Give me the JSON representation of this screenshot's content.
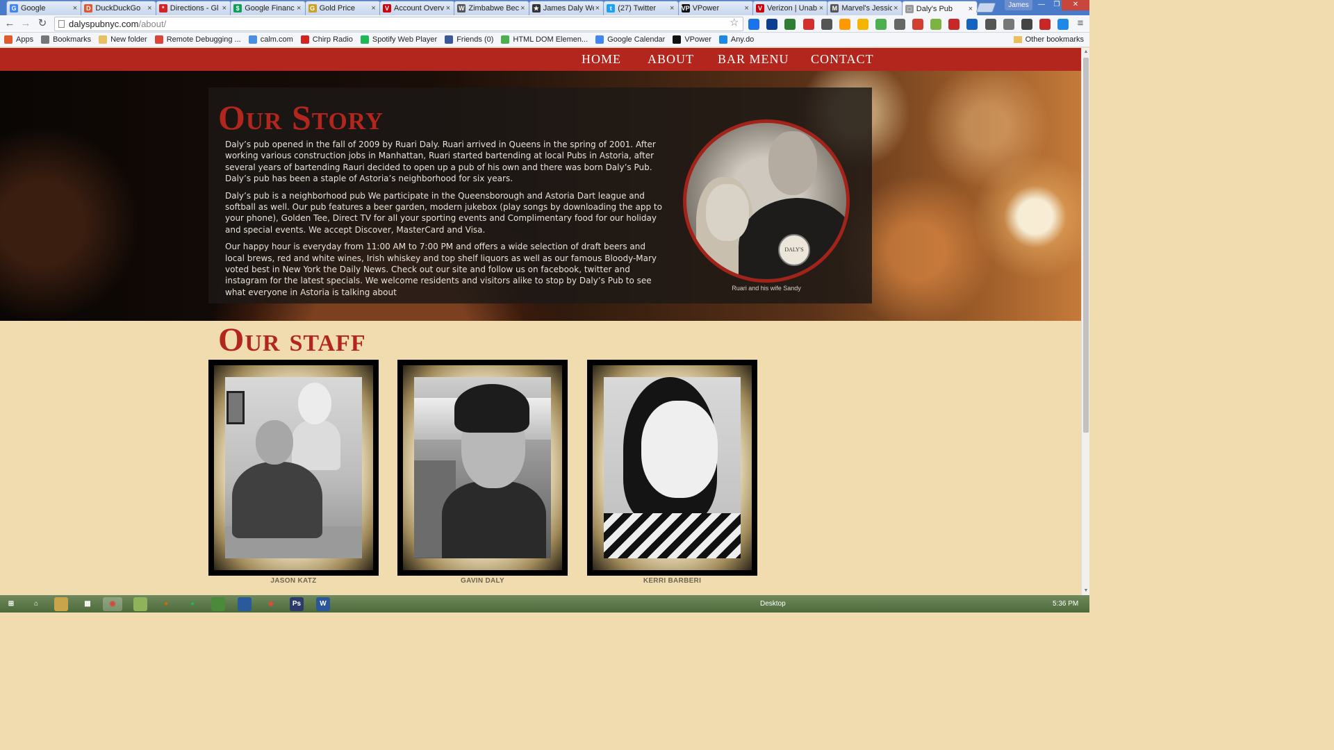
{
  "browser": {
    "tabs": [
      {
        "label": "Google",
        "fav": "G",
        "color": "#4285f4",
        "active": false
      },
      {
        "label": "DuckDuckGo",
        "fav": "D",
        "color": "#de5833",
        "active": false
      },
      {
        "label": "Directions - Gl",
        "fav": "*",
        "color": "#d32323",
        "active": false
      },
      {
        "label": "Google Financ",
        "fav": "$",
        "color": "#0f9d58",
        "active": false
      },
      {
        "label": "Gold Price",
        "fav": "G",
        "color": "#c9a227",
        "active": false
      },
      {
        "label": "Account Overv",
        "fav": "V",
        "color": "#cd040b",
        "active": false
      },
      {
        "label": "Zimbabwe Bec",
        "fav": "W",
        "color": "#555555",
        "active": false
      },
      {
        "label": "James Daly We",
        "fav": "★",
        "color": "#333333",
        "active": false
      },
      {
        "label": "(27) Twitter",
        "fav": "t",
        "color": "#1da1f2",
        "active": false
      },
      {
        "label": "VPower",
        "fav": "VP",
        "color": "#111111",
        "active": false
      },
      {
        "label": "Verizon | Unab",
        "fav": "V",
        "color": "#cd040b",
        "active": false
      },
      {
        "label": "Marvel's Jessic",
        "fav": "M",
        "color": "#555555",
        "active": false
      },
      {
        "label": "Daly's Pub",
        "fav": "□",
        "color": "#999999",
        "active": true
      }
    ],
    "tab_close": "×",
    "profile_name": "James",
    "url_host": "dalyspubnyc.com",
    "url_path": "/about/",
    "nav_back": "←",
    "nav_forward": "→",
    "nav_reload": "↻",
    "star": "☆",
    "menu": "≡",
    "bookmarks": [
      {
        "label": "Apps",
        "icon": "apps-icon",
        "color": "#e0592a"
      },
      {
        "label": "Bookmarks",
        "icon": "star-icon",
        "color": "#777777"
      },
      {
        "label": "New folder",
        "icon": "folder-icon",
        "color": "#e8c060"
      },
      {
        "label": "Remote Debugging ...",
        "icon": "chrome-icon",
        "color": "#db4437"
      },
      {
        "label": "calm.com",
        "icon": "calm-icon",
        "color": "#4a90e2"
      },
      {
        "label": "Chirp Radio",
        "icon": "chirp-icon",
        "color": "#d32323"
      },
      {
        "label": "Spotify Web Player",
        "icon": "spotify-icon",
        "color": "#1db954"
      },
      {
        "label": "Friends (0)",
        "icon": "facebook-icon",
        "color": "#3b5998"
      },
      {
        "label": "HTML DOM Elemen...",
        "icon": "w3-icon",
        "color": "#4caf50"
      },
      {
        "label": "Google Calendar",
        "icon": "calendar-icon",
        "color": "#4285f4"
      },
      {
        "label": "VPower",
        "icon": "vpower-icon",
        "color": "#111111"
      },
      {
        "label": "Any.do",
        "icon": "anydo-icon",
        "color": "#1e88e5"
      }
    ],
    "other_bookmarks": "Other bookmarks"
  },
  "site": {
    "nav": [
      "Home",
      "About",
      "Bar Menu",
      "Contact"
    ],
    "story_title": "Our Story",
    "story_paragraphs": [
      "Daly’s pub opened in the fall of 2009 by Ruari Daly. Ruari arrived in Queens in the spring of 2001. After working various construction jobs in Manhattan, Ruari started bartending at local Pubs in Astoria, after several years of bartending Rauri decided to open up a pub of his own and there was born Daly’s Pub. Daly’s pub has been a staple of Astoria’s neighborhood for six years.",
      "Daly’s pub is a neighborhood pub We participate in the Queensborough and Astoria Dart league and softball as well. Our pub features a beer garden, modern jukebox (play songs by downloading the app to your phone), Golden Tee, Direct TV for all your sporting events and Complimentary food for our holiday and special events. We accept Discover, MasterCard and Visa.",
      "Our happy hour is everyday from 11:00 AM to 7:00 PM and offers a wide selection of draft beers and local brews, red and white wines, Irish whiskey and top shelf liquors as well as our famous Bloody-Mary voted best in New York the Daily News. Check out our site and follow us on facebook, twitter and instagram for the latest specials. We welcome residents and visitors alike to stop by Daly’s Pub to see what everyone in Astoria is talking about"
    ],
    "portrait_caption": "Ruari and his wife Sandy",
    "portrait_badge": "DALY'S",
    "staff_title": "Our staff",
    "staff": [
      {
        "name": "JASON KATZ"
      },
      {
        "name": "GAVIN DALY"
      },
      {
        "name": "KERRI BARBERI"
      }
    ],
    "accent_color": "#b3261e",
    "background_color": "#f0dcae"
  },
  "taskbar": {
    "desktop_label": "Desktop",
    "clock": "5:36 PM"
  }
}
